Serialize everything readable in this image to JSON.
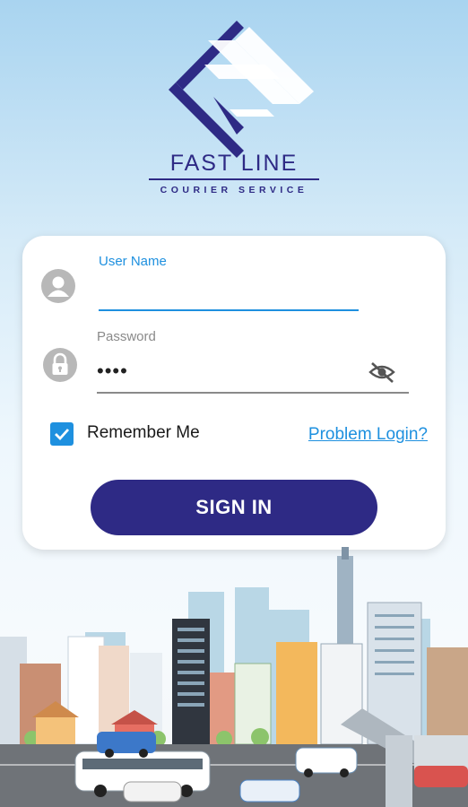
{
  "brand": {
    "name_part1": "FAST",
    "name_part2": "LINE",
    "tagline": "COURIER SERVICE"
  },
  "login": {
    "username_label": "User Name",
    "username_value": "",
    "password_label": "Password",
    "password_value": "••••",
    "remember_label": "Remember Me",
    "remember_checked": true,
    "problem_link": "Problem Login?",
    "signin_label": "SIGN IN"
  },
  "icons": {
    "user": "user-avatar-icon",
    "lock": "lock-icon",
    "eye": "eye-off-icon",
    "check": "checkmark-icon"
  },
  "colors": {
    "brand_navy": "#2e2a85",
    "accent_blue": "#1e90df",
    "icon_grey": "#b8b8b8"
  }
}
